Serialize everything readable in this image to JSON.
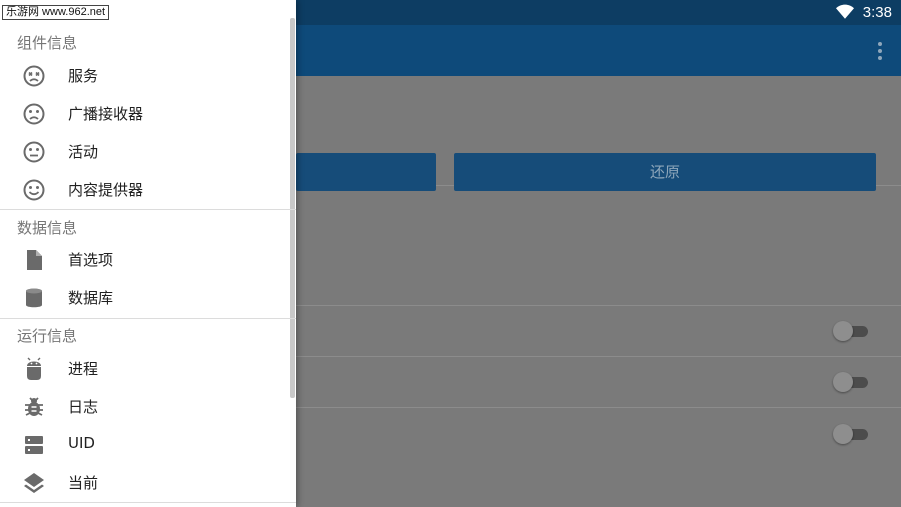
{
  "status_bar": {
    "time": "3:38",
    "wifi_icon": "wifi-icon"
  },
  "app_bar": {
    "overflow_icon": "more-vert-icon"
  },
  "watermark": "乐游网 www.962.net",
  "drawer": {
    "sections": [
      {
        "header": "组件信息",
        "items": [
          {
            "label": "服务",
            "icon": "face-dead-icon"
          },
          {
            "label": "广播接收器",
            "icon": "face-sad-icon"
          },
          {
            "label": "活动",
            "icon": "face-neutral-icon"
          },
          {
            "label": "内容提供器",
            "icon": "face-happy-icon"
          }
        ]
      },
      {
        "header": "数据信息",
        "items": [
          {
            "label": "首选项",
            "icon": "file-icon"
          },
          {
            "label": "数据库",
            "icon": "database-icon"
          }
        ]
      },
      {
        "header": "运行信息",
        "items": [
          {
            "label": "进程",
            "icon": "android-icon"
          },
          {
            "label": "日志",
            "icon": "bug-icon"
          },
          {
            "label": "UID",
            "icon": "server-icon"
          },
          {
            "label": "当前",
            "icon": "layers-icon"
          }
        ]
      }
    ]
  },
  "background": {
    "restore_button": "还原",
    "toggles": [
      false,
      false,
      false
    ]
  },
  "colors": {
    "status_bar": "#0d3d63",
    "app_bar": "#0e4a7a",
    "button": "#164c79",
    "drawer_bg": "#ffffff"
  }
}
